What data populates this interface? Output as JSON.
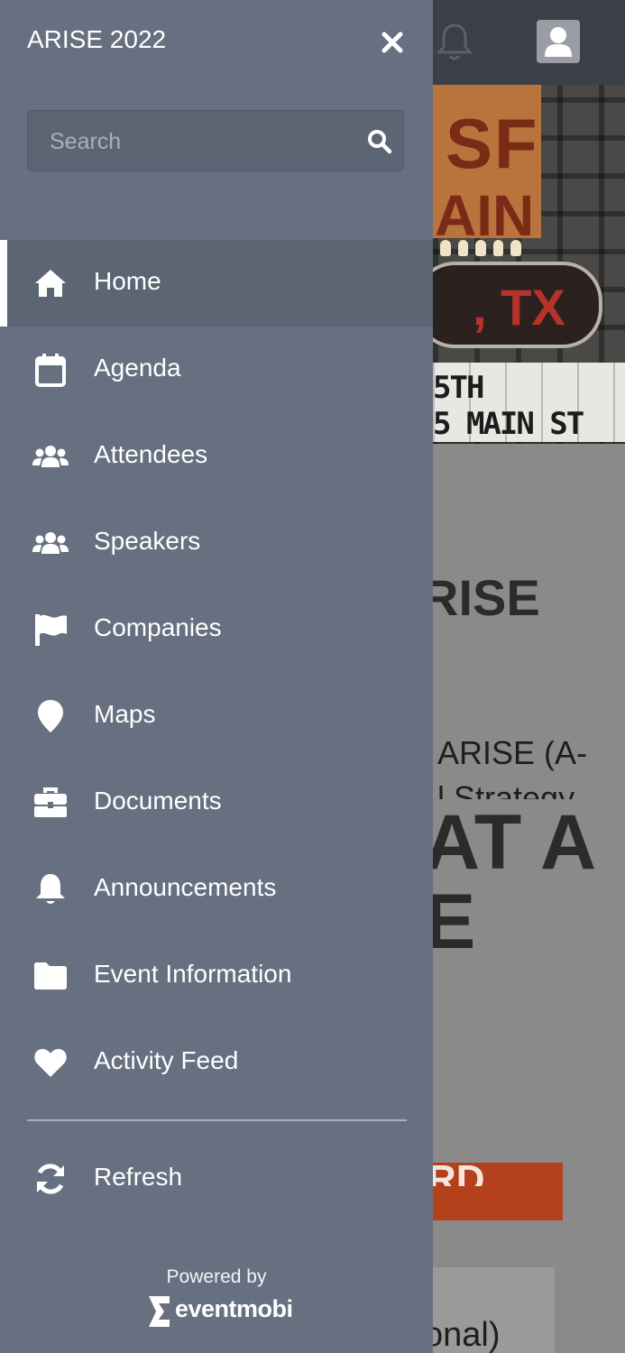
{
  "drawer": {
    "title": "ARISE 2022",
    "search_placeholder": "Search",
    "items": [
      {
        "label": "Home",
        "icon": "home-icon",
        "active": true
      },
      {
        "label": "Agenda",
        "icon": "calendar-icon"
      },
      {
        "label": "Attendees",
        "icon": "users-icon"
      },
      {
        "label": "Speakers",
        "icon": "users-icon"
      },
      {
        "label": "Companies",
        "icon": "flag-icon"
      },
      {
        "label": "Maps",
        "icon": "map-pin-icon"
      },
      {
        "label": "Documents",
        "icon": "briefcase-icon"
      },
      {
        "label": "Announcements",
        "icon": "bell-icon"
      },
      {
        "label": "Event Information",
        "icon": "folder-icon"
      },
      {
        "label": "Activity Feed",
        "icon": "heart-icon"
      }
    ],
    "refresh_label": "Refresh",
    "powered_by": "Powered by",
    "brand_name": "eventmobi"
  },
  "background": {
    "hero": {
      "sign_text_1": "SF",
      "sign_text_2": "AIN",
      "marquee_text": ", TX",
      "board_line_1": "5TH",
      "board_line_2": "5 MAIN ST"
    },
    "heading": "RISE",
    "paragraph_line_1": "ARISE (A-",
    "paragraph_line_2": "l Strategy",
    "headline": "AT A\nE",
    "button_text": "RD",
    "card_text": "onal)"
  },
  "colors": {
    "drawer_bg": "#667080",
    "active_bg": "#5b6574",
    "accent_button": "#b5401c"
  }
}
